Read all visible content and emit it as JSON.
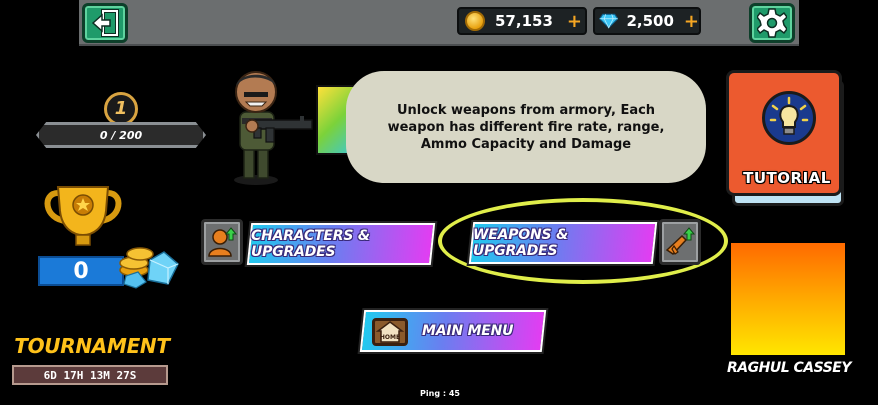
{
  "topbar": {
    "coins": "57,153",
    "gems": "2,500",
    "add_symbol": "+"
  },
  "player": {
    "level": "1",
    "xp_text": "0 / 200",
    "trophies": "0",
    "name": "RAGHUL CASSEY"
  },
  "tutorial": {
    "bubble_text": "Unlock weapons from armory, Each weapon has different fire rate, range, Ammo Capacity and Damage",
    "book_label": "TUTORIAL"
  },
  "buttons": {
    "characters": "CHARACTERS & UPGRADES",
    "weapons": "WEAPONS & UPGRADES",
    "main_menu": "MAIN MENU",
    "home_icon_text": "HOME"
  },
  "tournament": {
    "title": "TOURNAMENT",
    "timer": "6D 17H 13M 27S"
  },
  "status": {
    "ping": "Ping : 45"
  },
  "colors": {
    "accent_green": "#1f9b6a",
    "button_gradient_start": "#22c9ef",
    "button_gradient_end": "#e23df2",
    "highlight": "#e0ee4a",
    "tutorial_book": "#ec5a2f"
  }
}
